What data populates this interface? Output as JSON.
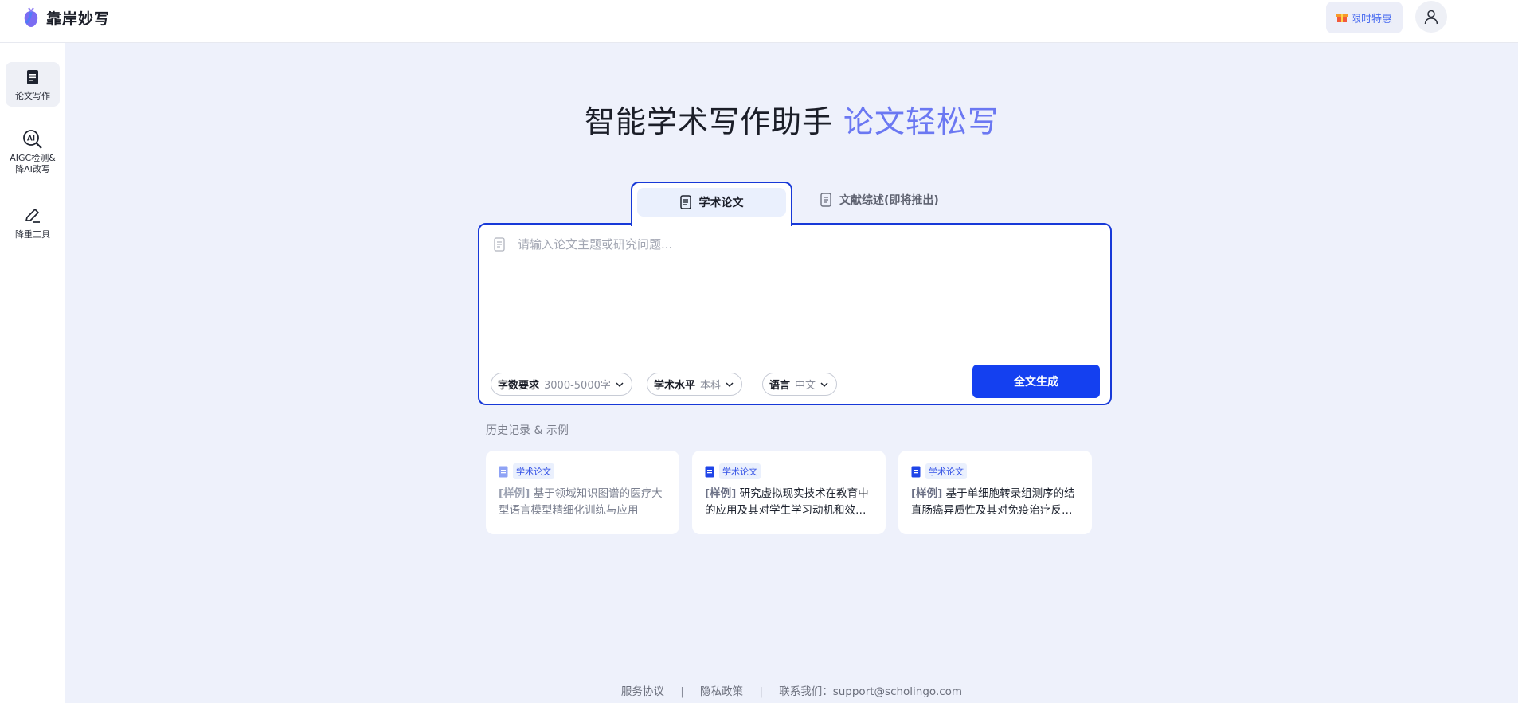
{
  "header": {
    "brand": "靠岸妙写",
    "promo_label": "限时特惠",
    "colors": {
      "accent": "#1440f0",
      "brand_purple": "#6b78f2"
    }
  },
  "sidebar": {
    "items": [
      {
        "label": "论文写作",
        "icon": "document-icon",
        "active": true
      },
      {
        "label_line1": "AIGC检测&",
        "label_line2": "降AI改写",
        "icon": "ai-search-icon",
        "active": false
      },
      {
        "label": "降重工具",
        "icon": "pen-icon",
        "active": false
      }
    ]
  },
  "hero": {
    "title": "智能学术写作助手",
    "accent": "论文轻松写"
  },
  "tabs": [
    {
      "label": "学术论文",
      "active": true
    },
    {
      "label": "文献综述(即将推出)",
      "active": false
    }
  ],
  "editor": {
    "placeholder": "请输入论文主题或研究问题...",
    "options": [
      {
        "key": "字数要求",
        "value": "3000-5000字"
      },
      {
        "key": "学术水平",
        "value": "本科"
      },
      {
        "key": "语言",
        "value": "中文"
      }
    ],
    "generate_label": "全文生成"
  },
  "history": {
    "title": "历史记录 & 示例",
    "cards": [
      {
        "badge": "学术论文",
        "prefix": "[样例]",
        "title": "基于领域知识图谱的医疗大型语言模型精细化训练与应用"
      },
      {
        "badge": "学术论文",
        "prefix": "[样例]",
        "title": "研究虚拟现实技术在教育中的应用及其对学生学习动机和效…"
      },
      {
        "badge": "学术论文",
        "prefix": "[样例]",
        "title": "基于单细胞转录组测序的结直肠癌异质性及其对免疫治疗反…"
      }
    ]
  },
  "footer": {
    "terms": "服务协议",
    "privacy": "隐私政策",
    "contact": "联系我们：support@scholingo.com"
  }
}
